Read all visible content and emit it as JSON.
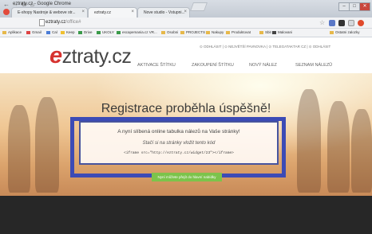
{
  "window": {
    "app_title": "eztraty.cz - Google Chrome",
    "tabs": [
      {
        "label": "E-shopy Nastroje & webove str..."
      },
      {
        "label": "eztraty.cz"
      },
      {
        "label": "Nove studio - Vstupni..."
      }
    ],
    "controls": [
      "–",
      "□",
      "✕"
    ]
  },
  "toolbar": {
    "url_domain": "eztraty.cz",
    "url_path": "/office#",
    "icons": [
      "back-icon",
      "forward-icon",
      "reload-icon",
      "home-icon",
      "star-icon"
    ]
  },
  "bookmarks": [
    "Aplikace",
    "Gmail",
    "Cal",
    "Keep",
    "Drive",
    "UKOLY",
    "escapemania.cz VR...",
    "Osobni",
    "PROJECTS",
    "Nakupy",
    "Produktovat",
    "Sbit",
    "Malovani",
    "Ostatni zalozky"
  ],
  "header": {
    "logo_e": "e",
    "logo_rest": "ztraty.cz",
    "top_nav": "⊙ ODHLÁSIT | ⊙ NEJVĚTŠÍ PAVNOVKA | ⊙ TELEGATAKTAR CZ | ⊙ ODHLÁSIT",
    "main_nav": [
      "AKTIVACE ŠTÍTKU",
      "ZAKOUPENÍ ŠTÍTKU",
      "NOVÝ NÁLEZ",
      "SEZNAM NÁLEZŮ"
    ]
  },
  "hero": {
    "title": "Registrace proběhla úspěšně!",
    "message_1": "A nyní slíbená online tabulka nálezů na Vaše stránky!",
    "message_2": "Stačí si na stránky vložit tento kód",
    "iframe_code": "<iframe src=\"http://eztraty.cz/widget/23\"></iframe>",
    "cta_label": "Nyní můžete přejít do hlavní nabídky"
  },
  "colors": {
    "accent_red": "#d6322f",
    "frame_blue": "#3c4bb5",
    "cta_green": "#7cc34b"
  }
}
